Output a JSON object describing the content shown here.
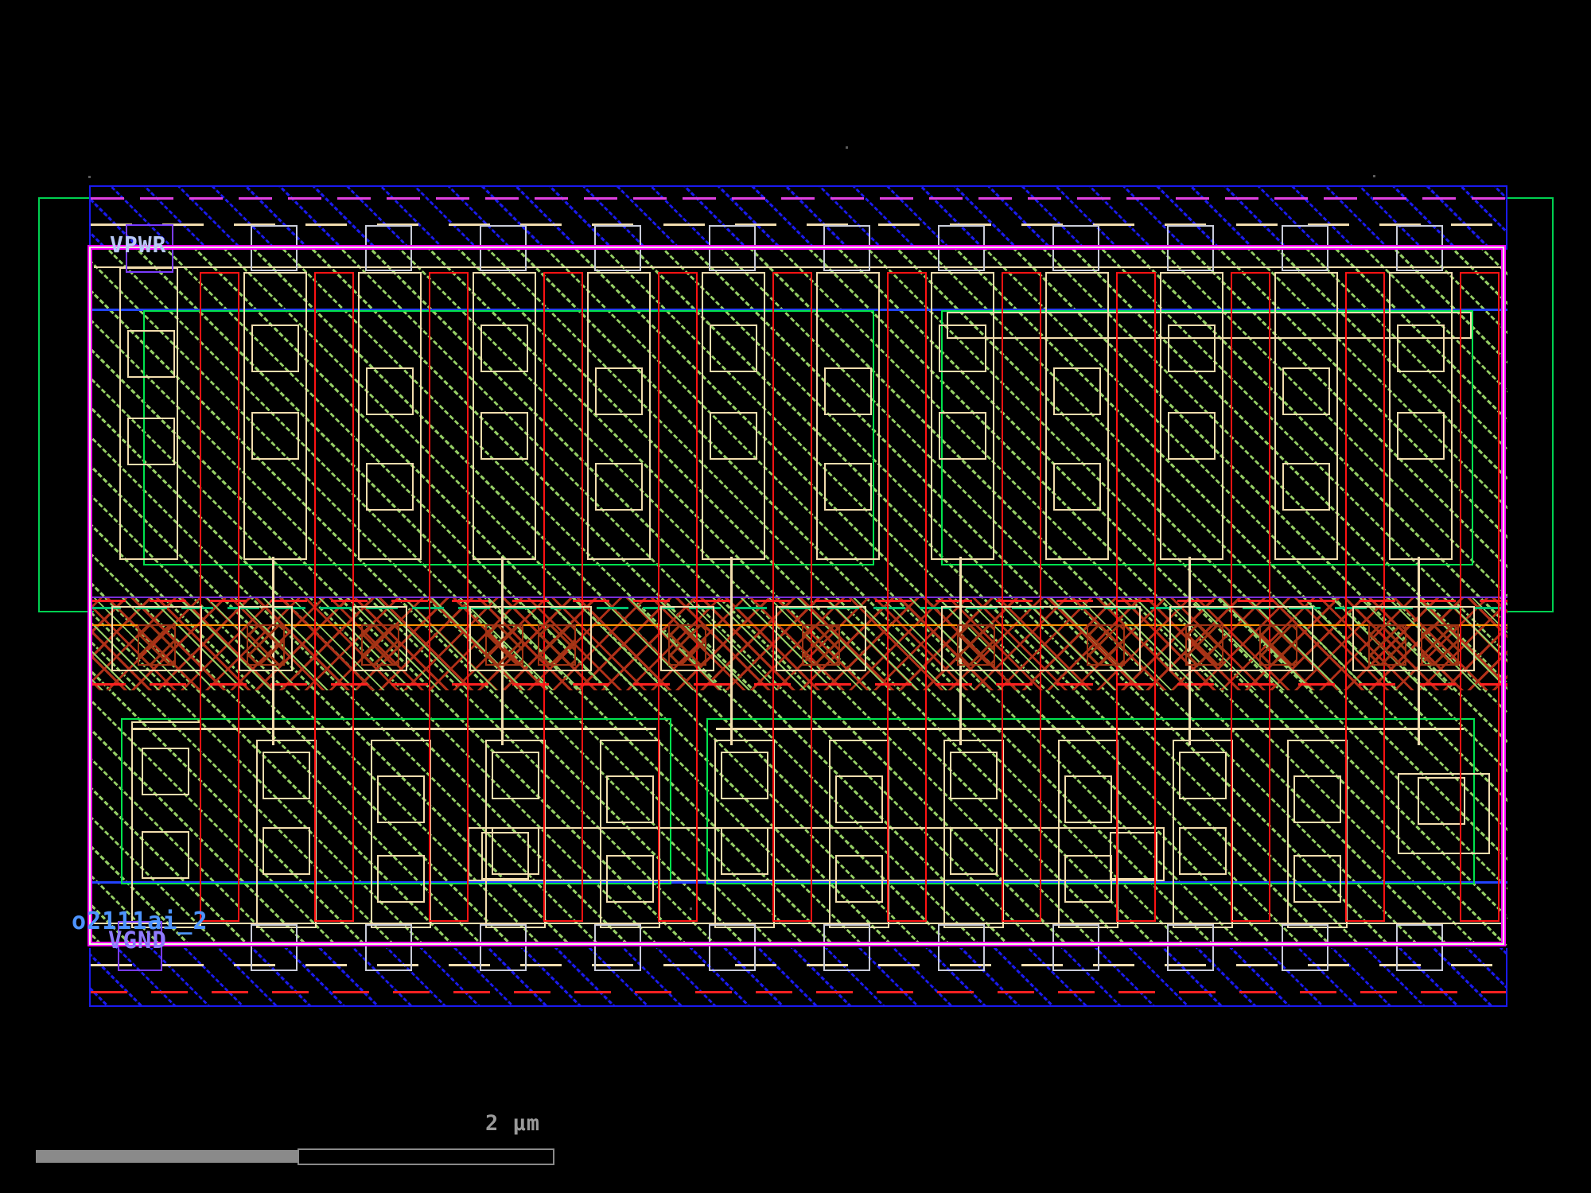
{
  "cell": {
    "name": "o2111ai_2",
    "power_label": "VPWR",
    "ground_label": "VGND"
  },
  "scale_bar": {
    "label": "2 µm"
  },
  "colors": {
    "metal1": "#1a1aee",
    "metal1_pin": "#7a3bff",
    "nwell": "#00d050",
    "diff": "#00e34e",
    "nsdm": "#2243ff",
    "poly": "#ff1212",
    "poly_hatch": "#b03018",
    "contact_hatch": "#a03414",
    "licon": "#f2ddae",
    "implant_hatch": "#96cf66",
    "boundary": "#ff00ff",
    "boundary_inner": "#eaffd8",
    "via": "#c9ccd9",
    "band_purple": "#7a30d8",
    "band_teal": "#00c070",
    "band_orange": "#ff9500",
    "rail_dash_pink": "#e040e0",
    "rail_dash_red": "#ff2020",
    "text_cellname": "#4d94ff",
    "text_vpwr": "#b9c9f6",
    "text_vgnd": "#8f7bff",
    "scale_gray": "#8a8a8a",
    "scale_text": "#9a9a9a"
  }
}
